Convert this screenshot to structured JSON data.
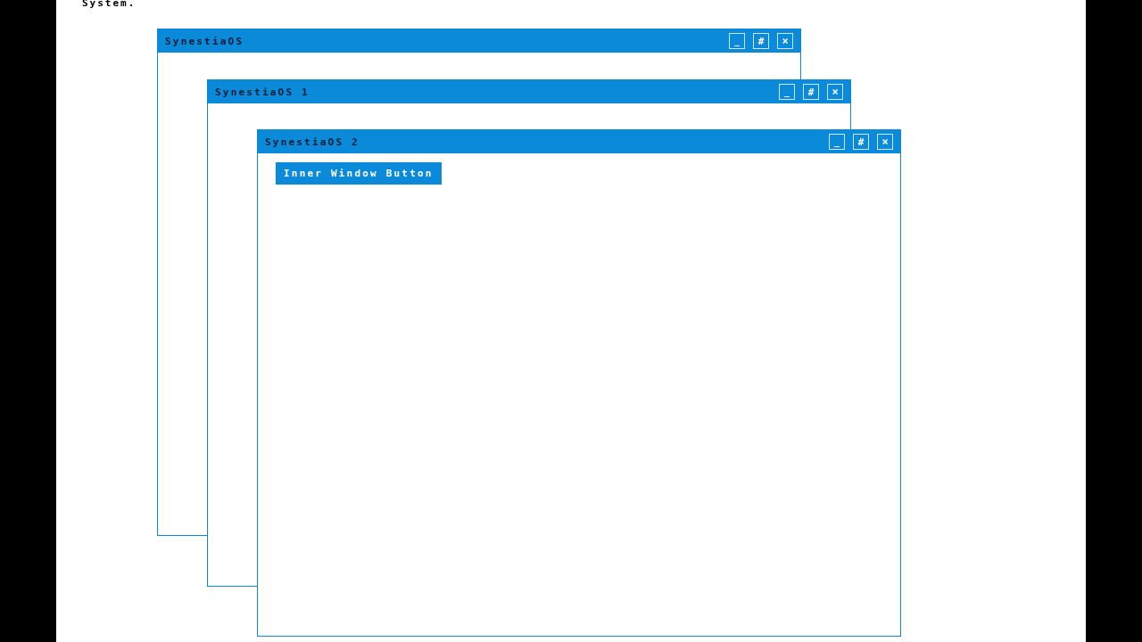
{
  "page_text": "System.",
  "windows": [
    {
      "title": "SynestiaOS",
      "controls": [
        {
          "kind": "minimize",
          "label": "_"
        },
        {
          "kind": "maximize",
          "label": "#"
        },
        {
          "kind": "close",
          "label": "×"
        }
      ]
    },
    {
      "title": "SynestiaOS 1",
      "controls": [
        {
          "kind": "minimize",
          "label": "_"
        },
        {
          "kind": "maximize",
          "label": "#"
        },
        {
          "kind": "close",
          "label": "×"
        }
      ]
    },
    {
      "title": "SynestiaOS 2",
      "controls": [
        {
          "kind": "minimize",
          "label": "_"
        },
        {
          "kind": "maximize",
          "label": "#"
        },
        {
          "kind": "close",
          "label": "×"
        }
      ],
      "buttons": [
        "Inner Window Button"
      ]
    }
  ]
}
